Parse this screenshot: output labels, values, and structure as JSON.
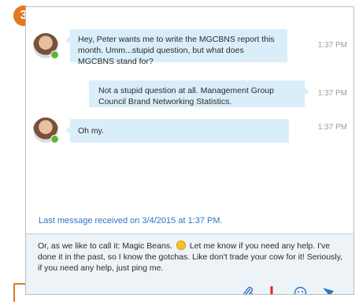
{
  "step_badge": "3",
  "conversation": {
    "messages": [
      {
        "direction": "incoming",
        "text": "Hey, Peter wants me to write the MGCBNS report this month. Umm...stupid question, but what does MGCBNS stand for?",
        "time": "1:37 PM"
      },
      {
        "direction": "outgoing",
        "text": "Not a stupid question at all. Management Group Council Brand Networking Statistics.",
        "time": "1:37 PM"
      },
      {
        "direction": "incoming",
        "text": "Oh my.",
        "time": "1:37 PM"
      }
    ],
    "last_received": "Last message received on 3/4/2015 at 1:37 PM."
  },
  "compose": {
    "text_before_emoji": "Or, as we like to call it: Magic Beans.",
    "text_after_emoji": "Let me know if you need any help. I've done it in the past, so I know the gotchas. Like don't trade your cow for it! Seriously, if you need any help, just ping me.",
    "inline_emoji": "smiley-emoji",
    "tools": [
      {
        "name": "attach",
        "icon": "paperclip-icon"
      },
      {
        "name": "priority",
        "icon": "exclamation-icon"
      },
      {
        "name": "emoticon",
        "icon": "smiley-icon"
      },
      {
        "name": "send",
        "icon": "send-icon"
      }
    ]
  },
  "colors": {
    "accent_blue": "#2a78c2",
    "bubble_bg": "#d9eef9",
    "compose_bg": "#eef3f7",
    "badge_orange": "#e07a1f",
    "presence_green": "#5fb538",
    "priority_red": "#e02020"
  }
}
